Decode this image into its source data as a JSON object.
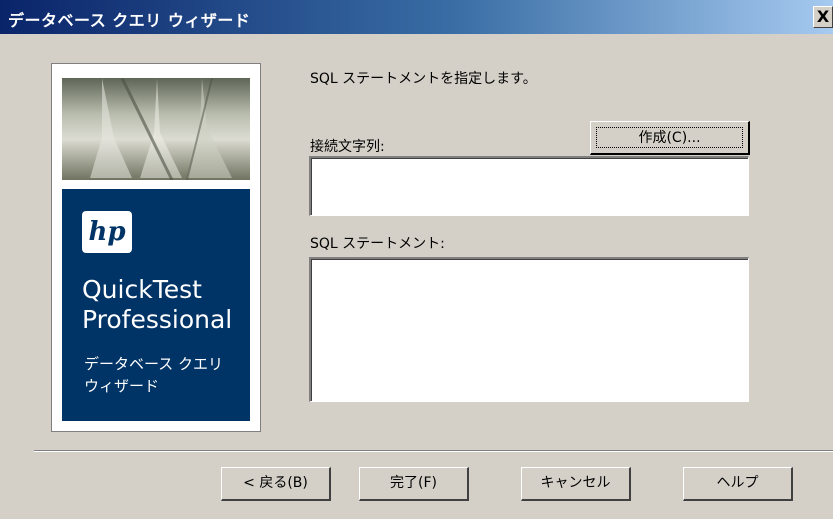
{
  "window": {
    "title": "データベース クエリ ウィザード",
    "close_label": "X"
  },
  "banner": {
    "logo_text": "hp",
    "product_name": "QuickTest\nProfessional",
    "subtitle": "データベース クエリ\nウィザード",
    "brand_color": "#003366"
  },
  "main": {
    "instruction": "SQL ステートメントを指定します。",
    "connection_label": "接続文字列:",
    "connection_value": "",
    "create_button": "作成(C)...",
    "sql_label": "SQL ステートメント:",
    "sql_value": ""
  },
  "footer": {
    "back": "< 戻る(B)",
    "finish": "完了(F)",
    "cancel": "キャンセル",
    "help": "ヘルプ"
  }
}
